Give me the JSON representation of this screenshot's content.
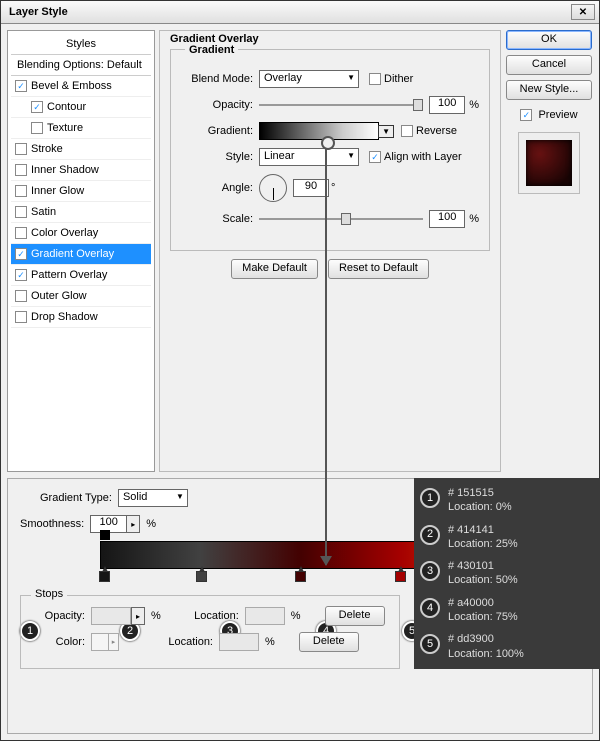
{
  "title": "Layer Style",
  "styles": {
    "header": "Styles",
    "blending": "Blending Options: Default",
    "items": [
      {
        "label": "Bevel & Emboss",
        "checked": true,
        "nested": false
      },
      {
        "label": "Contour",
        "checked": true,
        "nested": true
      },
      {
        "label": "Texture",
        "checked": false,
        "nested": true
      },
      {
        "label": "Stroke",
        "checked": false,
        "nested": false
      },
      {
        "label": "Inner Shadow",
        "checked": false,
        "nested": false
      },
      {
        "label": "Inner Glow",
        "checked": false,
        "nested": false
      },
      {
        "label": "Satin",
        "checked": false,
        "nested": false
      },
      {
        "label": "Color Overlay",
        "checked": false,
        "nested": false
      },
      {
        "label": "Gradient Overlay",
        "checked": true,
        "nested": false,
        "selected": true
      },
      {
        "label": "Pattern Overlay",
        "checked": true,
        "nested": false
      },
      {
        "label": "Outer Glow",
        "checked": false,
        "nested": false
      },
      {
        "label": "Drop Shadow",
        "checked": false,
        "nested": false
      }
    ]
  },
  "overlay": {
    "section": "Gradient Overlay",
    "fieldset": "Gradient",
    "blend_mode_label": "Blend Mode:",
    "blend_mode": "Overlay",
    "dither": "Dither",
    "opacity_label": "Opacity:",
    "opacity": "100",
    "pct": "%",
    "gradient_label": "Gradient:",
    "reverse": "Reverse",
    "style_label": "Style:",
    "style": "Linear",
    "align": "Align with Layer",
    "angle_label": "Angle:",
    "angle": "90",
    "deg": "°",
    "scale_label": "Scale:",
    "scale": "100",
    "make_default": "Make Default",
    "reset_default": "Reset to Default"
  },
  "right": {
    "ok": "OK",
    "cancel": "Cancel",
    "new_style": "New Style...",
    "preview": "Preview"
  },
  "editor": {
    "type_label": "Gradient Type:",
    "type": "Solid",
    "smooth_label": "Smoothness:",
    "smooth": "100",
    "pct": "%",
    "stops": "Stops",
    "opacity_label": "Opacity:",
    "location_label": "Location:",
    "color_label": "Color:",
    "delete": "Delete"
  },
  "annot": [
    {
      "hex": "# 151515",
      "loc": "Location: 0%"
    },
    {
      "hex": "# 414141",
      "loc": "Location: 25%"
    },
    {
      "hex": "# 430101",
      "loc": "Location: 50%"
    },
    {
      "hex": "# a40000",
      "loc": "Location: 75%"
    },
    {
      "hex": "# dd3900",
      "loc": "Location: 100%"
    }
  ],
  "chart_data": {
    "type": "table",
    "title": "Gradient color stops",
    "columns": [
      "stop",
      "hex",
      "location_pct"
    ],
    "rows": [
      [
        1,
        "#151515",
        0
      ],
      [
        2,
        "#414141",
        25
      ],
      [
        3,
        "#430101",
        50
      ],
      [
        4,
        "#a40000",
        75
      ],
      [
        5,
        "#dd3900",
        100
      ]
    ]
  }
}
